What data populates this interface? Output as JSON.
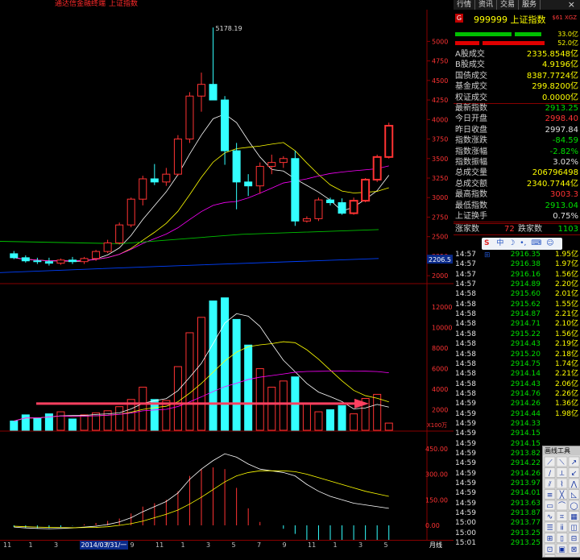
{
  "title": {
    "left": "通达信金融终端",
    "right": "上证指数"
  },
  "tabs": [
    "行情",
    "资讯",
    "交易",
    "服务"
  ],
  "chart": {
    "price_axis": [
      "5000",
      "4750",
      "4500",
      "4250",
      "4000",
      "3750",
      "3500",
      "3250",
      "3000",
      "2750",
      "2500",
      "2250",
      "2000"
    ],
    "price_marker": "2206.5",
    "peak_label": "5178.19",
    "vol_axis": [
      "12000",
      "10000",
      "8000",
      "6000",
      "4000",
      "2000"
    ],
    "vol_unit": "X100万",
    "macd_axis": [
      "450.00",
      "300.00",
      "150.00",
      "0.00"
    ],
    "dates": [
      "11",
      "1",
      "3",
      "2014/03/31/一",
      "7",
      "9",
      "11",
      "1",
      "3",
      "5",
      "7",
      "9",
      "11",
      "1",
      "3",
      "5"
    ],
    "period_label": "月线"
  },
  "colors": {
    "up": "#ff3333",
    "down": "#33ffff",
    "ma5": "#ffffff",
    "ma10": "#ffff00",
    "ma20": "#ff00ff",
    "ma60": "#00c000",
    "ma120": "#0040ff"
  },
  "chart_data": {
    "type": "candlestick",
    "period": "月线",
    "ohlc": [
      [
        2281,
        2316,
        2212,
        2230
      ],
      [
        2230,
        2260,
        2168,
        2190
      ],
      [
        2190,
        2230,
        2150,
        2180
      ],
      [
        2180,
        2230,
        2130,
        2160
      ],
      [
        2160,
        2220,
        2140,
        2200
      ],
      [
        2200,
        2240,
        2150,
        2180
      ],
      [
        2180,
        2240,
        2150,
        2220
      ],
      [
        2220,
        2330,
        2190,
        2310
      ],
      [
        2310,
        2460,
        2290,
        2420
      ],
      [
        2420,
        2680,
        2400,
        2650
      ],
      [
        2650,
        3000,
        2620,
        2980
      ],
      [
        2980,
        3280,
        2900,
        3240
      ],
      [
        3240,
        3430,
        3160,
        3200
      ],
      [
        3200,
        3380,
        3150,
        3300
      ],
      [
        3300,
        3800,
        3280,
        3750
      ],
      [
        3750,
        4350,
        3700,
        4300
      ],
      [
        4300,
        4600,
        4100,
        4450
      ],
      [
        4450,
        5178,
        4280,
        4250
      ],
      [
        4250,
        4300,
        3420,
        3600
      ],
      [
        3600,
        3700,
        2850,
        3200
      ],
      [
        3200,
        3300,
        3020,
        3150
      ],
      [
        3150,
        3450,
        3050,
        3400
      ],
      [
        3400,
        3550,
        3300,
        3450
      ],
      [
        3450,
        3530,
        3380,
        3500
      ],
      [
        3500,
        3600,
        2638,
        2700
      ],
      [
        2700,
        2760,
        2680,
        2730
      ],
      [
        2730,
        3000,
        2700,
        2970
      ],
      [
        2970,
        3000,
        2900,
        2935
      ],
      [
        2935,
        2990,
        2780,
        2800
      ],
      [
        2800,
        3000,
        2780,
        2960
      ],
      [
        2960,
        3250,
        2940,
        3230
      ],
      [
        3230,
        3550,
        3200,
        3520
      ],
      [
        3520,
        3960,
        3500,
        3920
      ]
    ],
    "volume": [
      900,
      1500,
      1200,
      1600,
      1800,
      1100,
      1500,
      1700,
      1900,
      2300,
      3000,
      4200,
      3000,
      2900,
      6200,
      9500,
      11000,
      12600,
      12900,
      10800,
      8300,
      6000,
      4200,
      4800,
      5200,
      2600,
      1800,
      2000,
      2400,
      1600,
      3100,
      3500,
      700
    ]
  },
  "panel": {
    "code": "999999 上证指数",
    "sub": "$61 XGZ",
    "bar1": "33.0亿",
    "bar2": "52.0亿",
    "rows": [
      {
        "label": "A股成交",
        "value": "2335.8548亿",
        "color": "#ffff00"
      },
      {
        "label": "B股成交",
        "value": "4.9196亿",
        "color": "#ffff00"
      },
      {
        "label": "国债成交",
        "value": "8387.7724亿",
        "color": "#ffff00"
      },
      {
        "label": "基金成交",
        "value": "299.8200亿",
        "color": "#ffff00"
      },
      {
        "label": "权证成交",
        "value": "0.0000亿",
        "color": "#ffff00"
      },
      {
        "label": "最新指数",
        "value": "2913.25",
        "color": "#00e000"
      },
      {
        "label": "今日开盘",
        "value": "2998.40",
        "color": "#ff3333"
      },
      {
        "label": "昨日收盘",
        "value": "2997.84",
        "color": "#e0e0e0"
      },
      {
        "label": "指数涨跌",
        "value": "-84.59",
        "color": "#00e000"
      },
      {
        "label": "指数涨幅",
        "value": "-2.82%",
        "color": "#00e000"
      },
      {
        "label": "指数振幅",
        "value": "3.02%",
        "color": "#e0e0e0"
      },
      {
        "label": "总成交量",
        "value": "206796498",
        "color": "#ffff00"
      },
      {
        "label": "总成交额",
        "value": "2340.7744亿",
        "color": "#ffff00"
      },
      {
        "label": "最高指数",
        "value": "3003.3",
        "color": "#ff3333"
      },
      {
        "label": "最低指数",
        "value": "2913.04",
        "color": "#00e000"
      },
      {
        "label": "上证换手",
        "value": "0.75%",
        "color": "#e0e0e0"
      }
    ],
    "breadth": {
      "up_label": "涨家数",
      "up": "72",
      "down_label": "跌家数",
      "down": "1103"
    },
    "ticks": [
      {
        "t": "14:57",
        "p": "2916.35",
        "v": "1.95亿"
      },
      {
        "t": "14:57",
        "p": "2916.38",
        "v": "1.97亿"
      },
      {
        "t": "14:57",
        "p": "2916.16",
        "v": "1.56亿"
      },
      {
        "t": "14:57",
        "p": "2914.89",
        "v": "2.20亿"
      },
      {
        "t": "14:58",
        "p": "2915.60",
        "v": "2.01亿"
      },
      {
        "t": "14:58",
        "p": "2915.62",
        "v": "1.55亿"
      },
      {
        "t": "14:58",
        "p": "2914.87",
        "v": "2.21亿"
      },
      {
        "t": "14:58",
        "p": "2914.71",
        "v": "2.10亿"
      },
      {
        "t": "14:58",
        "p": "2915.22",
        "v": "1.56亿"
      },
      {
        "t": "14:58",
        "p": "2914.43",
        "v": "2.19亿"
      },
      {
        "t": "14:58",
        "p": "2915.20",
        "v": "2.18亿"
      },
      {
        "t": "14:58",
        "p": "2914.75",
        "v": "1.74亿"
      },
      {
        "t": "14:58",
        "p": "2914.14",
        "v": "2.21亿"
      },
      {
        "t": "14:58",
        "p": "2914.43",
        "v": "2.06亿"
      },
      {
        "t": "14:58",
        "p": "2914.76",
        "v": "2.26亿"
      },
      {
        "t": "14:59",
        "p": "2914.26",
        "v": "1.36亿"
      },
      {
        "t": "14:59",
        "p": "2914.44",
        "v": "1.98亿"
      },
      {
        "t": "14:59",
        "p": "2914.33",
        "v": ""
      },
      {
        "t": "14:59",
        "p": "2914.15",
        "v": ""
      },
      {
        "t": "14:59",
        "p": "2914.15",
        "v": ""
      },
      {
        "t": "14:59",
        "p": "2913.82",
        "v": ""
      },
      {
        "t": "14:59",
        "p": "2914.22",
        "v": ""
      },
      {
        "t": "14:59",
        "p": "2914.26",
        "v": ""
      },
      {
        "t": "14:59",
        "p": "2913.97",
        "v": ""
      },
      {
        "t": "14:59",
        "p": "2914.01",
        "v": ""
      },
      {
        "t": "14:59",
        "p": "2913.63",
        "v": ""
      },
      {
        "t": "14:59",
        "p": "2913.87",
        "v": ""
      },
      {
        "t": "15:00",
        "p": "2913.77",
        "v": ""
      },
      {
        "t": "15:00",
        "p": "2913.25",
        "v": ""
      },
      {
        "t": "15:01",
        "p": "2913.25",
        "v": ""
      }
    ],
    "tools_title": "画线工具"
  }
}
